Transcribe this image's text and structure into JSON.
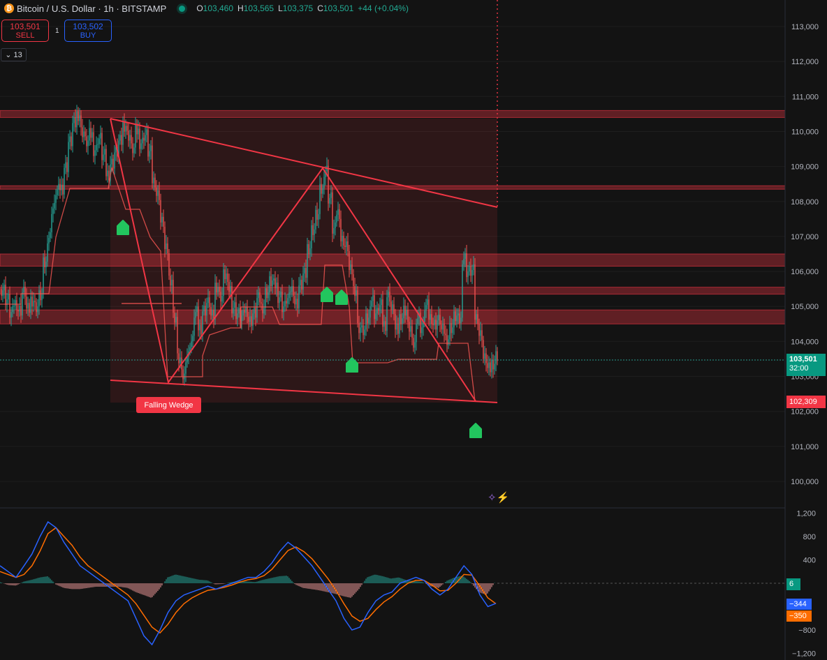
{
  "header": {
    "symbol_title": "Bitcoin / U.S. Dollar · 1h · BITSTAMP",
    "coin_icon": "bitcoin-icon",
    "open_label": "O",
    "open": "103,460",
    "high_label": "H",
    "high": "103,565",
    "low_label": "L",
    "low": "103,375",
    "close_label": "C",
    "close": "103,501",
    "change": "+44 (+0.04%)"
  },
  "trade": {
    "sell_price": "103,501",
    "sell_label": "SELL",
    "qty": "1",
    "buy_price": "103,502",
    "buy_label": "BUY"
  },
  "indicators_toggle": {
    "count": "13",
    "icon": "chevron-down-icon"
  },
  "pattern_label": "Falling Wedge",
  "price_tag": {
    "price": "103,501",
    "countdown": "32:00"
  },
  "low_tag": "102,309",
  "osc_tags": {
    "hist": "6",
    "macd": "−344",
    "signal": "−350"
  },
  "colors": {
    "background": "#131313",
    "up": "#26a69a",
    "down": "#ef5350",
    "pattern": "#f23645",
    "macd_line": "#2962ff",
    "signal_line": "#ff6d00",
    "marker": "#22c55e"
  },
  "chart_data": [
    {
      "type": "candlestick",
      "title": "Bitcoin / U.S. Dollar · 1h · BITSTAMP",
      "y_ticks": [
        "100,000",
        "101,000",
        "102,000",
        "103,000",
        "104,000",
        "105,000",
        "106,000",
        "107,000",
        "108,000",
        "109,000",
        "110,000",
        "111,000",
        "112,000",
        "113,000"
      ],
      "ylim": [
        99400,
        113600
      ],
      "grid": true,
      "close_path": [
        [
          0,
          105500
        ],
        [
          3,
          105200
        ],
        [
          6,
          104800
        ],
        [
          9,
          105100
        ],
        [
          12,
          104900
        ],
        [
          15,
          105400
        ],
        [
          18,
          104900
        ],
        [
          21,
          105200
        ],
        [
          24,
          105000
        ],
        [
          27,
          105300
        ],
        [
          30,
          106200
        ],
        [
          33,
          107000
        ],
        [
          36,
          107800
        ],
        [
          39,
          108300
        ],
        [
          42,
          108400
        ],
        [
          45,
          109000
        ],
        [
          48,
          109700
        ],
        [
          51,
          110200
        ],
        [
          54,
          110500
        ],
        [
          57,
          110000
        ],
        [
          60,
          109700
        ],
        [
          63,
          109900
        ],
        [
          66,
          109500
        ],
        [
          69,
          109800
        ],
        [
          72,
          109300
        ],
        [
          75,
          108800
        ],
        [
          78,
          109100
        ],
        [
          81,
          109400
        ],
        [
          84,
          109700
        ],
        [
          87,
          110200
        ],
        [
          90,
          109900
        ],
        [
          93,
          109500
        ],
        [
          96,
          110000
        ],
        [
          99,
          109700
        ],
        [
          102,
          109900
        ],
        [
          105,
          109400
        ],
        [
          108,
          108600
        ],
        [
          111,
          108200
        ],
        [
          114,
          107400
        ],
        [
          117,
          106600
        ],
        [
          120,
          105800
        ],
        [
          123,
          104700
        ],
        [
          126,
          103500
        ],
        [
          129,
          103000
        ],
        [
          132,
          103600
        ],
        [
          135,
          104000
        ],
        [
          138,
          104800
        ],
        [
          141,
          104400
        ],
        [
          144,
          104900
        ],
        [
          147,
          105100
        ],
        [
          150,
          104700
        ],
        [
          153,
          105600
        ],
        [
          156,
          105300
        ],
        [
          159,
          105900
        ],
        [
          162,
          105500
        ],
        [
          165,
          105000
        ],
        [
          168,
          104800
        ],
        [
          171,
          104700
        ],
        [
          174,
          104900
        ],
        [
          177,
          104600
        ],
        [
          180,
          104800
        ],
        [
          183,
          105200
        ],
        [
          186,
          105000
        ],
        [
          189,
          105400
        ],
        [
          192,
          105700
        ],
        [
          195,
          105600
        ],
        [
          198,
          105300
        ],
        [
          201,
          105000
        ],
        [
          204,
          105200
        ],
        [
          207,
          105500
        ],
        [
          210,
          105100
        ],
        [
          213,
          105600
        ],
        [
          216,
          105900
        ],
        [
          219,
          106700
        ],
        [
          222,
          107200
        ],
        [
          225,
          107600
        ],
        [
          228,
          108300
        ],
        [
          231,
          108900
        ],
        [
          234,
          108100
        ],
        [
          237,
          107200
        ],
        [
          240,
          107700
        ],
        [
          243,
          106900
        ],
        [
          246,
          106700
        ],
        [
          249,
          106000
        ],
        [
          252,
          105500
        ],
        [
          255,
          104400
        ],
        [
          258,
          104300
        ],
        [
          261,
          104600
        ],
        [
          264,
          105200
        ],
        [
          267,
          104800
        ],
        [
          270,
          105000
        ],
        [
          273,
          104500
        ],
        [
          276,
          105300
        ],
        [
          279,
          104900
        ],
        [
          282,
          104300
        ],
        [
          285,
          104700
        ],
        [
          288,
          104900
        ],
        [
          291,
          104400
        ],
        [
          294,
          103900
        ],
        [
          297,
          104700
        ],
        [
          300,
          104400
        ],
        [
          303,
          105000
        ],
        [
          306,
          104700
        ],
        [
          309,
          104500
        ],
        [
          312,
          104600
        ],
        [
          315,
          104300
        ],
        [
          318,
          104100
        ],
        [
          321,
          104400
        ],
        [
          324,
          104700
        ],
        [
          327,
          104600
        ],
        [
          330,
          106400
        ],
        [
          333,
          106000
        ],
        [
          336,
          106000
        ],
        [
          339,
          104700
        ],
        [
          342,
          104200
        ],
        [
          345,
          103500
        ],
        [
          348,
          103200
        ],
        [
          351,
          103400
        ],
        [
          354,
          103600
        ]
      ],
      "markers": [
        "buy-arrow",
        "buy-arrow",
        "buy-arrow",
        "buy-arrow",
        "buy-arrow"
      ],
      "pattern": {
        "name": "Falling Wedge",
        "upper_line": [
          [
            110400
          ],
          [
            107850
          ]
        ],
        "lower_line": [
          [
            102890
          ],
          [
            102250
          ]
        ],
        "zigzag": [
          110400,
          102800,
          109000,
          102309
        ]
      },
      "zones": [
        [
          110400,
          110600
        ],
        [
          108350,
          108450
        ],
        [
          106150,
          106500
        ],
        [
          105350,
          105550
        ],
        [
          104500,
          104900
        ]
      ]
    },
    {
      "type": "line",
      "title": "MACD",
      "y_ticks": [
        "1,200",
        "800",
        "400",
        "−800",
        "−1,200"
      ],
      "ylim": [
        -1220,
        1220
      ],
      "series": [
        {
          "values": [
            300,
            200,
            100,
            300,
            500,
            800,
            1050,
            950,
            700,
            500,
            300,
            200,
            100,
            0,
            -100,
            -200,
            -300,
            -600,
            -900,
            -1050,
            -800,
            -500,
            -300,
            -200,
            -150,
            -100,
            -50,
            -100,
            -50,
            0,
            50,
            100,
            100,
            200,
            350,
            550,
            700,
            600,
            450,
            300,
            100,
            -100,
            -300,
            -600,
            -800,
            -750,
            -500,
            -300,
            -200,
            -150,
            0,
            50,
            100,
            50,
            -100,
            -200,
            -100,
            100,
            300,
            150,
            -200,
            -400,
            -344
          ]
        },
        {
          "values": [
            200,
            150,
            100,
            150,
            300,
            550,
            850,
            950,
            800,
            650,
            450,
            300,
            200,
            100,
            0,
            -100,
            -200,
            -350,
            -550,
            -750,
            -850,
            -700,
            -500,
            -350,
            -250,
            -180,
            -120,
            -100,
            -70,
            -30,
            20,
            60,
            80,
            130,
            240,
            400,
            560,
            620,
            540,
            420,
            250,
            80,
            -120,
            -350,
            -560,
            -650,
            -600,
            -450,
            -320,
            -230,
            -100,
            0,
            50,
            50,
            -30,
            -130,
            -120,
            0,
            150,
            140,
            -50,
            -250,
            -350
          ]
        },
        {
          "values": [
            20,
            -30,
            -40,
            30,
            60,
            100,
            120,
            -20,
            -80,
            -100,
            -100,
            -80,
            -60,
            -60,
            -60,
            -60,
            -80,
            -150,
            -200,
            -250,
            -100,
            100,
            150,
            120,
            90,
            60,
            50,
            -20,
            -10,
            20,
            40,
            30,
            20,
            60,
            90,
            120,
            130,
            -20,
            -80,
            -100,
            -120,
            -150,
            -180,
            -220,
            -250,
            -100,
            100,
            150,
            120,
            80,
            100,
            50,
            40,
            20,
            -50,
            -80,
            40,
            100,
            130,
            20,
            -150,
            -200,
            6
          ]
        }
      ]
    }
  ]
}
